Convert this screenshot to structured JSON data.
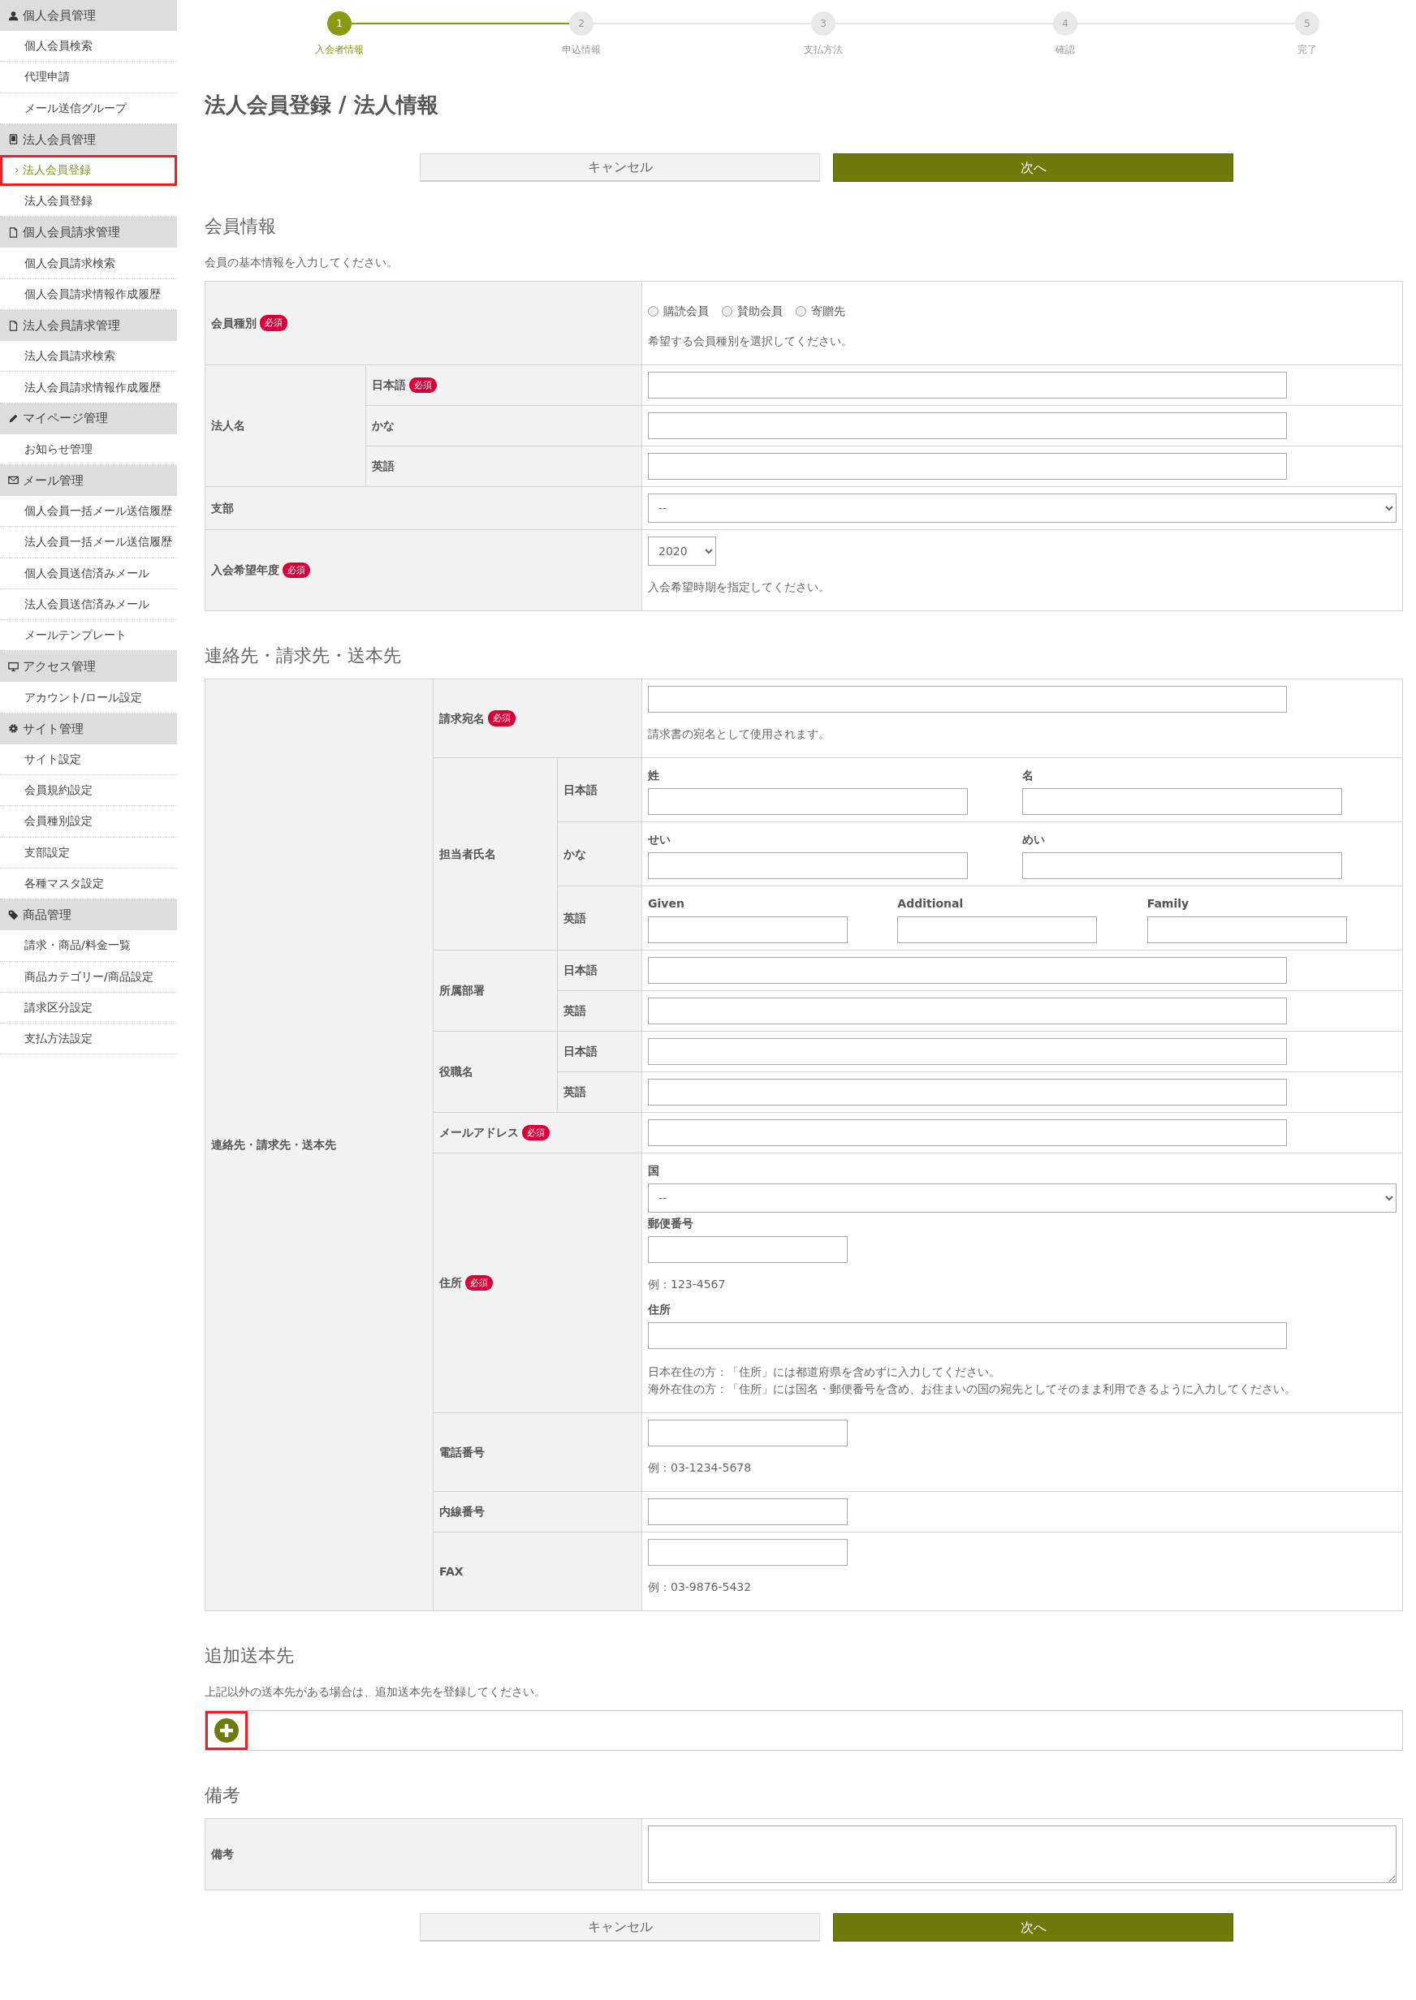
{
  "sidebar": [
    {
      "title": "個人会員管理",
      "kind": "person",
      "items": [
        {
          "label": "個人会員検索",
          "selected": false
        },
        {
          "label": "代理申請",
          "selected": false
        },
        {
          "label": "メール送信グループ",
          "selected": false
        }
      ]
    },
    {
      "title": "法人会員管理",
      "kind": "building",
      "items": [
        {
          "label": "法人会員登録",
          "selected": true,
          "prefix": "›"
        },
        {
          "label": "法人会員登録",
          "selected": false
        }
      ]
    },
    {
      "title": "個人会員請求管理",
      "kind": "document",
      "items": [
        {
          "label": "個人会員請求検索",
          "selected": false
        },
        {
          "label": "個人会員請求情報作成履歴",
          "selected": false
        }
      ]
    },
    {
      "title": "法人会員請求管理",
      "kind": "document",
      "items": [
        {
          "label": "法人会員請求検索",
          "selected": false
        },
        {
          "label": "法人会員請求情報作成履歴",
          "selected": false
        }
      ]
    },
    {
      "title": "マイページ管理",
      "kind": "pencil",
      "items": [
        {
          "label": "お知らせ管理",
          "selected": false
        }
      ]
    },
    {
      "title": "メール管理",
      "kind": "envelope",
      "items": [
        {
          "label": "個人会員一括メール送信履歴",
          "selected": false
        },
        {
          "label": "法人会員一括メール送信履歴",
          "selected": false
        },
        {
          "label": "個人会員送信済みメール",
          "selected": false
        },
        {
          "label": "法人会員送信済みメール",
          "selected": false
        },
        {
          "label": "メールテンプレート",
          "selected": false
        }
      ]
    },
    {
      "title": "アクセス管理",
      "kind": "monitor",
      "items": [
        {
          "label": "アカウント/ロール設定",
          "selected": false
        }
      ]
    },
    {
      "title": "サイト管理",
      "kind": "gear",
      "items": [
        {
          "label": "サイト設定",
          "selected": false
        },
        {
          "label": "会員規約設定",
          "selected": false
        },
        {
          "label": "会員種別設定",
          "selected": false
        },
        {
          "label": "支部設定",
          "selected": false
        },
        {
          "label": "各種マスタ設定",
          "selected": false
        }
      ]
    },
    {
      "title": "商品管理",
      "kind": "tag",
      "items": [
        {
          "label": "請求・商品/料金一覧",
          "selected": false
        },
        {
          "label": "商品カテゴリー/商品設定",
          "selected": false
        },
        {
          "label": "請求区分設定",
          "selected": false
        },
        {
          "label": "支払方法設定",
          "selected": false
        }
      ]
    }
  ],
  "steps": [
    {
      "number": "1",
      "label": "入会者情報",
      "selected": true
    },
    {
      "number": "2",
      "label": "申込情報",
      "selected": false
    },
    {
      "number": "3",
      "label": "支払方法",
      "selected": false
    },
    {
      "number": "4",
      "label": "確認",
      "selected": false
    },
    {
      "number": "5",
      "label": "完了",
      "selected": false
    }
  ],
  "page_title": "法人会員登録 / 法人情報",
  "top_buttons": [
    {
      "label": "キャンセル",
      "kind": "secondary"
    },
    {
      "label": "次へ",
      "kind": "primary"
    }
  ],
  "sections": [
    {
      "heading": "会員情報",
      "note": "会員の基本情報を入力してください。",
      "table": {
        "rows": [
          {
            "label": "会員種別",
            "badge": "必須",
            "content": [
              {
                "kind": "radios",
                "options": [
                  {
                    "label": "購読会員",
                    "selected": false
                  },
                  {
                    "label": "賛助会員",
                    "selected": false
                  },
                  {
                    "label": "寄贈先",
                    "selected": false
                  }
                ]
              },
              {
                "kind": "note",
                "text": "希望する会員種別を選択してください。"
              }
            ]
          },
          {
            "label": "法人名",
            "subrows": [
              {
                "label": "日本語",
                "badge": "必須",
                "content": [
                  {
                    "kind": "input_long"
                  }
                ]
              },
              {
                "label": "かな",
                "content": [
                  {
                    "kind": "input_long"
                  }
                ]
              },
              {
                "label": "英語",
                "content": [
                  {
                    "kind": "input_long"
                  }
                ]
              }
            ]
          },
          {
            "label": "支部",
            "content": [
              {
                "kind": "select_full",
                "value": "--"
              }
            ]
          },
          {
            "label": "入会希望年度",
            "badge": "必須",
            "content": [
              {
                "kind": "select_small",
                "value": "2020"
              },
              {
                "kind": "note",
                "text": "入会希望時期を指定してください。"
              }
            ]
          }
        ]
      }
    },
    {
      "heading": "連絡先・請求先・送本先",
      "table": {
        "outer_label": "連絡先・請求先・送本先",
        "rows": [
          {
            "label": "請求宛名",
            "badge": "必須",
            "content": [
              {
                "kind": "input_long"
              },
              {
                "kind": "note",
                "text": "請求書の宛名として使用されます。"
              }
            ]
          },
          {
            "label": "担当者氏名",
            "subrows": [
              {
                "label": "日本語",
                "content": [
                  {
                    "kind": "columns",
                    "cols": [
                      "姓",
                      "名"
                    ]
                  }
                ]
              },
              {
                "label": "かな",
                "content": [
                  {
                    "kind": "columns",
                    "cols": [
                      "せい",
                      "めい"
                    ]
                  }
                ]
              },
              {
                "label": "英語",
                "content": [
                  {
                    "kind": "columns",
                    "cols": [
                      "Given",
                      "Additional",
                      "Family"
                    ]
                  }
                ]
              }
            ]
          },
          {
            "label": "所属部署",
            "subrows": [
              {
                "label": "日本語",
                "content": [
                  {
                    "kind": "input_long"
                  }
                ]
              },
              {
                "label": "英語",
                "content": [
                  {
                    "kind": "input_long"
                  }
                ]
              }
            ]
          },
          {
            "label": "役職名",
            "subrows": [
              {
                "label": "日本語",
                "content": [
                  {
                    "kind": "input_long"
                  }
                ]
              },
              {
                "label": "英語",
                "content": [
                  {
                    "kind": "input_long"
                  }
                ]
              }
            ]
          },
          {
            "label": "メールアドレス",
            "badge": "必須",
            "content": [
              {
                "kind": "input_long"
              }
            ]
          },
          {
            "label": "住所",
            "badge": "必須",
            "content": [
              {
                "kind": "field_label",
                "text": "国"
              },
              {
                "kind": "select_full",
                "value": "--"
              },
              {
                "kind": "field_label",
                "text": "郵便番号"
              },
              {
                "kind": "input_short"
              },
              {
                "kind": "note",
                "text": "例：123-4567"
              },
              {
                "kind": "field_label",
                "text": "住所"
              },
              {
                "kind": "input_long"
              },
              {
                "kind": "note_lines",
                "lines": [
                  "日本在住の方：「住所」には都道府県を含めずに入力してください。",
                  "海外在住の方：「住所」には国名・郵便番号を含め、お住まいの国の宛先としてそのまま利用できるように入力してください。"
                ]
              }
            ]
          },
          {
            "label": "電話番号",
            "content": [
              {
                "kind": "input_short"
              },
              {
                "kind": "note",
                "text": "例：03-1234-5678"
              }
            ]
          },
          {
            "label": "内線番号",
            "content": [
              {
                "kind": "input_short"
              }
            ]
          },
          {
            "label": "FAX",
            "content": [
              {
                "kind": "input_short"
              },
              {
                "kind": "note",
                "text": "例：03-9876-5432"
              }
            ]
          }
        ]
      }
    },
    {
      "heading": "追加送本先",
      "note": "上記以外の送本先がある場合は、追加送本先を登録してください。",
      "add_button": {
        "highlighted": true
      }
    },
    {
      "heading": "備考",
      "table": {
        "rows": [
          {
            "label": "備考",
            "content": [
              {
                "kind": "textarea"
              }
            ]
          }
        ]
      }
    }
  ],
  "bottom_buttons": [
    {
      "label": "キャンセル",
      "kind": "secondary"
    },
    {
      "label": "次へ",
      "kind": "primary"
    }
  ]
}
